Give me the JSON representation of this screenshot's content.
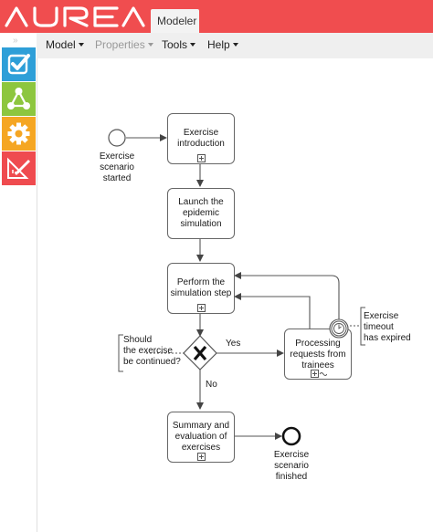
{
  "app": {
    "logo_text": "AUREA",
    "tab_label": "Modeler"
  },
  "menu": [
    {
      "label": "Model",
      "disabled": false
    },
    {
      "label": "Properties",
      "disabled": false
    },
    {
      "label": "Tools",
      "disabled": false
    },
    {
      "label": "Help",
      "disabled": false
    }
  ],
  "sidebar": {
    "collapse_glyph": "»",
    "items": [
      {
        "icon": "checklist-icon",
        "color": "#2e9fd8"
      },
      {
        "icon": "network-icon",
        "color": "#8dc63f"
      },
      {
        "icon": "gear-icon",
        "color": "#f5a623"
      },
      {
        "icon": "ruler-pencil-icon",
        "color": "#ef4b4f"
      }
    ]
  },
  "diagram": {
    "start_event": "Exercise\nscenario\nstarted",
    "task_intro": "Exercise\nintroduction",
    "task_launch": "Launch the\nepidemic\nsimulation",
    "task_perform": "Perform the\nsimulation step",
    "gateway_question": "Should\nthe exercise\nbe continued?",
    "flow_yes": "Yes",
    "flow_no": "No",
    "task_processing": "Processing\nrequests from\ntrainees",
    "timer_annotation": "Exercise\ntimeout\nhas expired",
    "task_summary": "Summary and\nevaluation of\nexercises",
    "end_event": "Exercise\nscenario\nfinished"
  },
  "colors": {
    "brand": "#f04d4f",
    "menubar": "#efefef"
  }
}
